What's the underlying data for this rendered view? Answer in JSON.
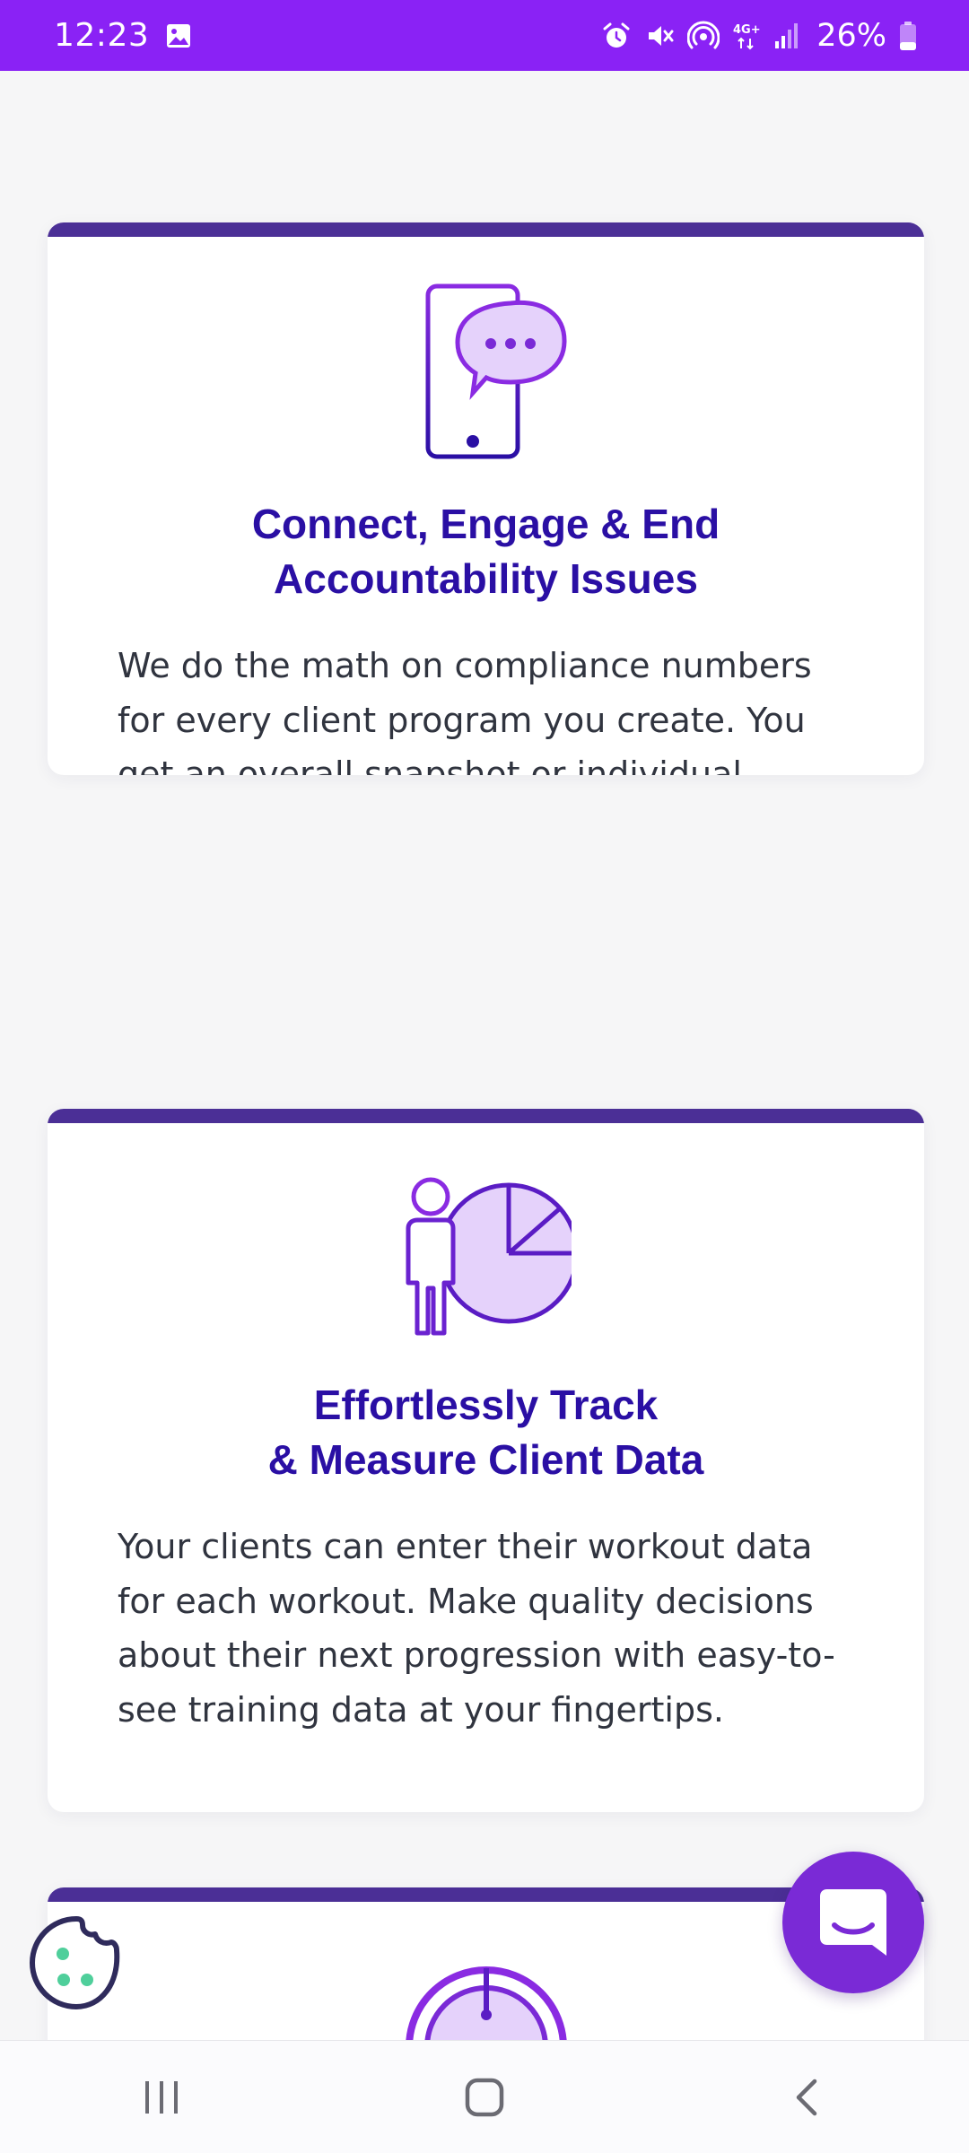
{
  "status_bar": {
    "time": "12:23",
    "battery_text": "26%",
    "network_label": "4G+",
    "icons": [
      "image-icon",
      "alarm-icon",
      "mute-icon",
      "hotspot-icon",
      "network-4g-icon",
      "signal-icon",
      "battery-icon"
    ]
  },
  "cards": [
    {
      "icon": "phone-chat-icon",
      "title_lines": [
        "Connect, Engage & End",
        "Accountability Issues"
      ],
      "body": "We do the math on compliance numbers for every client program you create. You get an overall snapshot or individual details so you can give your attention to clients who need it, and use your coaching skills to move them forward."
    },
    {
      "icon": "person-pie-chart-icon",
      "title_lines": [
        "Effortlessly Track",
        "& Measure Client Data"
      ],
      "body": "Your clients can enter their workout data for each workout. Make quality decisions about their next progression with easy-to-see training data at your fingertips."
    },
    {
      "icon": "stopwatch-icon"
    }
  ],
  "floating": {
    "chat_icon": "chat-icon",
    "cookie_icon": "cookie-icon"
  },
  "nav_bar": {
    "icons": [
      "recent-apps-icon",
      "home-icon",
      "back-icon"
    ]
  },
  "colors": {
    "status_bar": "#8a22f5",
    "card_accent": "#4b2f96",
    "title": "#2a0fa4",
    "body_text": "#30343f",
    "chat_button": "#7a2ad6",
    "cookie": "#2f2b5c",
    "cookie_dots": "#4fcf9b"
  }
}
